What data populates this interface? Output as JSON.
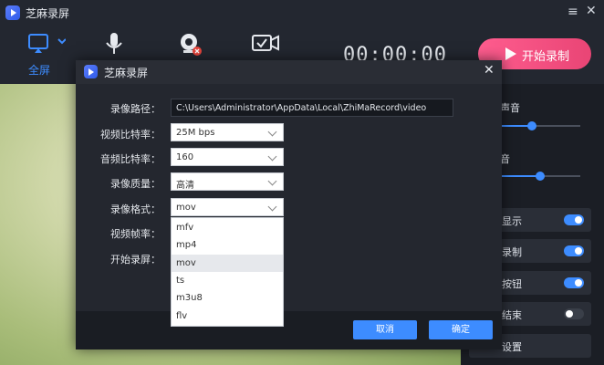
{
  "app": {
    "title": "芝麻录屏"
  },
  "toolbar": {
    "fullscreen_label": "全屏",
    "timer": "00:00:00",
    "start_label": "开始录制"
  },
  "panel": {
    "audio1_label": "声音",
    "audio1_level": 0.4,
    "audio2_label": "音",
    "audio2_level": 0.5,
    "rows": [
      {
        "text": "显示",
        "on": true
      },
      {
        "text": "录制",
        "on": true
      },
      {
        "text": "按钮",
        "on": true
      },
      {
        "text": "结束",
        "on": false
      },
      {
        "text": "设置"
      }
    ]
  },
  "dialog": {
    "title": "芝麻录屏",
    "path_label": "录像路径：",
    "path_value": "C:\\Users\\Administrator\\AppData\\Local\\ZhiMaRecord\\video",
    "video_bitrate_label": "视频比特率：",
    "video_bitrate_value": "25M bps",
    "audio_bitrate_label": "音频比特率：",
    "audio_bitrate_value": "160",
    "quality_label": "录像质量：",
    "quality_value": "高清",
    "format_label": "录像格式：",
    "format_value": "mov",
    "framerate_label": "视频帧率：",
    "start_label": "开始录屏：",
    "format_options": [
      "mfv",
      "mp4",
      "mov",
      "ts",
      "m3u8",
      "flv"
    ],
    "selected_option": "mov",
    "cancel_label": "取消",
    "ok_label": "确定"
  },
  "colors": {
    "accent": "#3d8cff",
    "start": "#ff5d8f"
  }
}
